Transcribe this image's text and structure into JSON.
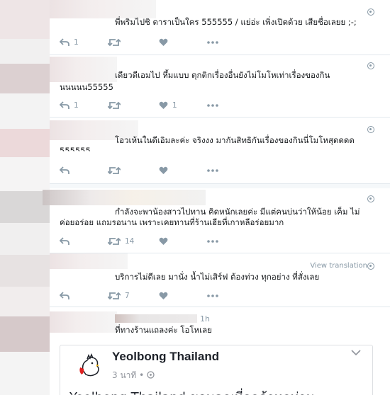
{
  "tweets": [
    {
      "text": "พี่พริมไปชิ ดาราเป็นใคร 555555 / แย่อ่ะ เพิ่งเปิดด้วย เสียชื่อเลยย ;-;",
      "reply_count": "1",
      "retweet_count": "",
      "like_count": ""
    },
    {
      "text_line1": "เดียวดีเอมไป หึ้มแบบ ตุกติกเรื่องอื่นยังไม่โมโหเท่าเรื่องของกิน",
      "text_line2": "นนนนน55555",
      "reply_count": "1",
      "retweet_count": "",
      "like_count": "1"
    },
    {
      "text_line1": "โอวเห้นในดีเอิมละค่ะ จริงงง มากันสิทธิกันเรื่องของกินนี่โมโหสุดดดด",
      "text_line2": "555555",
      "reply_count": "",
      "retweet_count": "",
      "like_count": ""
    },
    {
      "text_line1": "กำลังจะพาน้องสาวไปทาน คิดหนักเลยค่ะ มีแต่คนบ่นว่าให้น้อย เค็ม ไม่",
      "text_line2": "ค่อยอร่อย แถมรอนาน เพราะเคยทานที่ร้านเฮียที่เกาหลีอร่อยมาก",
      "reply_count": "",
      "retweet_count": "14",
      "like_count": ""
    },
    {
      "text": "บริการไม่ดีเลย มานั่ง น้ำไม่เสิร์ฟ ต้องท่วง ทุกอย่าง ที่สั่งเลย",
      "view_translation": "View translation",
      "reply_count": "",
      "retweet_count": "7",
      "like_count": ""
    },
    {
      "timestamp": "1h",
      "text": "ที่ทางร้านแถลงค่ะ โอโหเลย"
    }
  ],
  "facebook_card": {
    "page_name": "Yeolbong Thailand",
    "time": "3 นาที • ",
    "body_partial": "Yeolbong Thailand ขอบคุณที่ลูกค้าทุกท่าน ..."
  },
  "colors": {
    "action_gray": "#8899a6",
    "border": "#e1e8ed",
    "fb_border": "#dddfe2"
  },
  "icons": [
    "reply-icon",
    "retweet-icon",
    "like-icon",
    "more-icon",
    "globe-icon",
    "chevron-down-icon",
    "chicken-logo"
  ]
}
